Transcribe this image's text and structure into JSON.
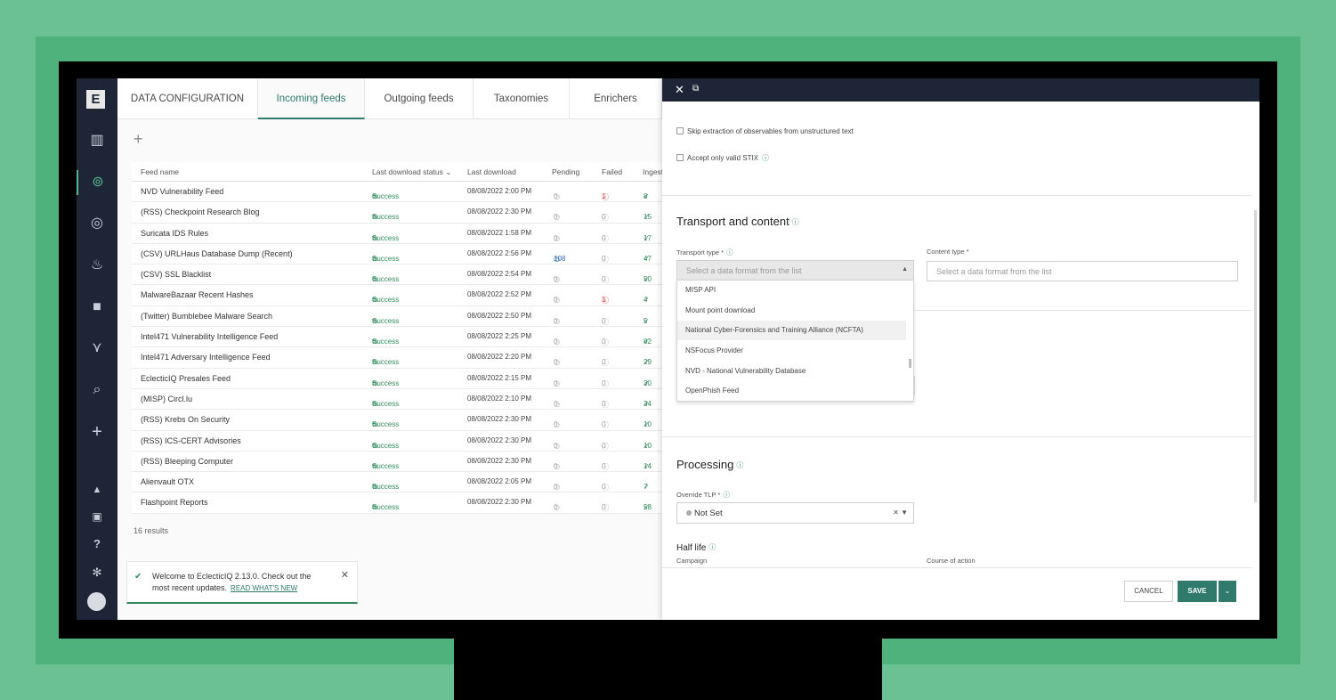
{
  "nav": {
    "logo": "E",
    "icons": [
      {
        "name": "chart-icon",
        "glyph": "▥"
      },
      {
        "name": "robot-icon",
        "glyph": "⊚"
      },
      {
        "name": "target-icon",
        "glyph": "◎"
      },
      {
        "name": "fire-icon",
        "glyph": "♨"
      },
      {
        "name": "briefcase-icon",
        "glyph": "■"
      },
      {
        "name": "graph-icon",
        "glyph": "⋎"
      },
      {
        "name": "search-icon",
        "glyph": "⌕"
      },
      {
        "name": "plus-icon",
        "glyph": "+"
      },
      {
        "name": "bell-icon",
        "glyph": "▲"
      },
      {
        "name": "calendar-icon",
        "glyph": "▣"
      },
      {
        "name": "help-icon",
        "glyph": "?"
      },
      {
        "name": "gear-icon",
        "glyph": "✻"
      }
    ]
  },
  "tabs": [
    "DATA CONFIGURATION",
    "Incoming feeds",
    "Outgoing feeds",
    "Taxonomies",
    "Enrichers"
  ],
  "table": {
    "headers": [
      "Feed name",
      "Last download status",
      "Last download",
      "Pending",
      "Failed",
      "Ingest"
    ],
    "rows": [
      {
        "name": "NVD Vulnerability Feed",
        "status": "Success",
        "dl": "08/08/2022 2:00 PM",
        "pending": "0",
        "failed": "1",
        "ingested": "8",
        "failed_alert": true
      },
      {
        "name": "(RSS) Checkpoint Research Blog",
        "status": "Success",
        "dl": "08/08/2022 2:30 PM",
        "pending": "0",
        "failed": "0",
        "ingested": "15"
      },
      {
        "name": "Suricata IDS Rules",
        "status": "Success",
        "dl": "08/08/2022 1:58 PM",
        "pending": "0",
        "failed": "0",
        "ingested": "17"
      },
      {
        "name": "(CSV) URLHaus Database Dump (Recent)",
        "status": "Success",
        "dl": "08/08/2022 2:56 PM",
        "pending": "108",
        "failed": "0",
        "ingested": "47",
        "pending_active": true
      },
      {
        "name": "(CSV) SSL Blacklist",
        "status": "Success",
        "dl": "08/08/2022 2:54 PM",
        "pending": "0",
        "failed": "0",
        "ingested": "50"
      },
      {
        "name": "MalwareBazaar Recent Hashes",
        "status": "Success",
        "dl": "08/08/2022 2:52 PM",
        "pending": "0",
        "failed": "1",
        "ingested": "4",
        "failed_alert": true
      },
      {
        "name": "(Twitter) Bumblebee Malware Search",
        "status": "Success",
        "dl": "08/08/2022 2:50 PM",
        "pending": "0",
        "failed": "0",
        "ingested": "5"
      },
      {
        "name": "Intel471 Vulnerability Intelligence Feed",
        "status": "Success",
        "dl": "08/08/2022 2:25 PM",
        "pending": "0",
        "failed": "0",
        "ingested": "82"
      },
      {
        "name": "Intel471 Adversary Intelligence Feed",
        "status": "Success",
        "dl": "08/08/2022 2:20 PM",
        "pending": "0",
        "failed": "0",
        "ingested": "29"
      },
      {
        "name": "EclecticIQ Presales Feed",
        "status": "Success",
        "dl": "08/08/2022 2:15 PM",
        "pending": "0",
        "failed": "0",
        "ingested": "30"
      },
      {
        "name": "(MISP) Circl.lu",
        "status": "Success",
        "dl": "08/08/2022 2:10 PM",
        "pending": "0",
        "failed": "0",
        "ingested": "34"
      },
      {
        "name": "(RSS) Krebs On Security",
        "status": "Success",
        "dl": "08/08/2022 2:30 PM",
        "pending": "0",
        "failed": "0",
        "ingested": "10"
      },
      {
        "name": "(RSS) ICS-CERT Advisories",
        "status": "Success",
        "dl": "08/08/2022 2:30 PM",
        "pending": "0",
        "failed": "0",
        "ingested": "10"
      },
      {
        "name": "(RSS) Bleeping Computer",
        "status": "Success",
        "dl": "08/08/2022 2:30 PM",
        "pending": "0",
        "failed": "0",
        "ingested": "14"
      },
      {
        "name": "Alienvault OTX",
        "status": "Success",
        "dl": "08/08/2022 2:05 PM",
        "pending": "0",
        "failed": "0",
        "ingested": "7"
      },
      {
        "name": "Flashpoint Reports",
        "status": "Success",
        "dl": "08/08/2022 2:30 PM",
        "pending": "0",
        "failed": "0",
        "ingested": "58"
      }
    ],
    "results": "16 results"
  },
  "toast": {
    "line1": "Welcome to EclecticIQ 2.13.0. Check out the",
    "line2": "most recent updates.",
    "link": "READ WHAT'S NEW"
  },
  "drawer": {
    "checkbox1": "Skip extraction of observables from unstructured text",
    "checkbox2": "Accept only valid STIX",
    "transport_title": "Transport and content",
    "transport_label": "Transport type *",
    "transport_placeholder": "Select a data format from the list",
    "content_label": "Content type *",
    "content_placeholder": "Select a data format from the list",
    "options": [
      "MISP API",
      "Mount point download",
      "National Cyber-Forensics and Training Alliance (NCFTA)",
      "NSFocus Provider",
      "NVD - National Vulnerability Database",
      "OpenPhish Feed"
    ],
    "processing_title": "Processing",
    "tlp_label": "Override TLP *",
    "tlp_value": "Not Set",
    "halflife_title": "Half life",
    "campaign_label": "Campaign",
    "coa_label": "Course of action",
    "cancel": "CANCEL",
    "save": "SAVE"
  },
  "colors": {
    "accent": "#2f7a6a",
    "nav_bg": "#1e2536",
    "success": "#2f8a5c",
    "alert": "#d9403a"
  }
}
